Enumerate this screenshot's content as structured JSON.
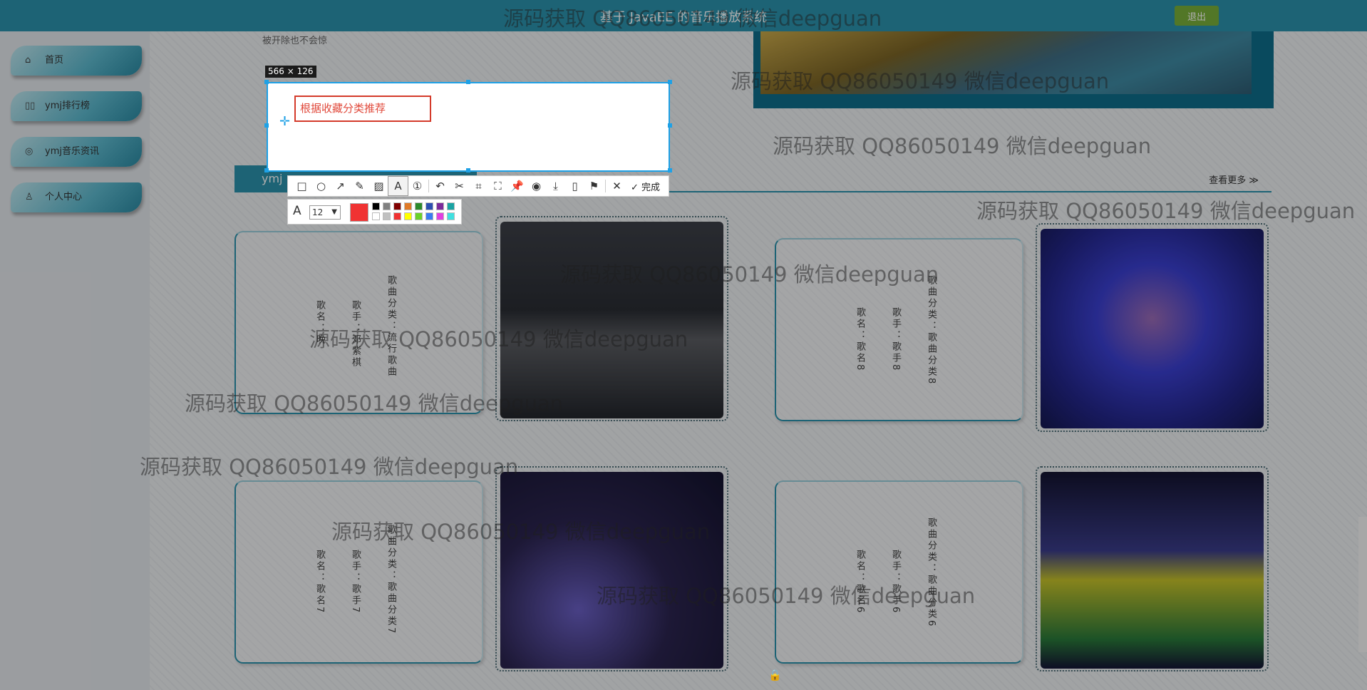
{
  "header": {
    "title": "基于 JavaEE 的音乐播放系统",
    "logout_label": "退出"
  },
  "sidebar": {
    "items": [
      {
        "icon": "home-icon",
        "label": "首页"
      },
      {
        "icon": "rank-icon",
        "label": "ymj排行榜"
      },
      {
        "icon": "news-icon",
        "label": "ymj音乐资讯"
      },
      {
        "icon": "user-icon",
        "label": "个人中心"
      }
    ]
  },
  "main": {
    "note": "被开除也不会惊",
    "section_title": "ymj",
    "more_label": "查看更多 ≫"
  },
  "songs": [
    {
      "name": "歌名：晚",
      "singer": "歌手：邓紫棋",
      "category": "歌曲分类：流行歌曲",
      "image_colors": [
        "#31343c",
        "#5a5d63",
        "#1e2228"
      ]
    },
    {
      "name": "歌名：歌名8",
      "singer": "歌手：歌手8",
      "category": "歌曲分类：歌曲分类8",
      "image_colors": [
        "#2b2f9a",
        "#3a3fd0",
        "#1a1d6b"
      ]
    },
    {
      "name": "歌名：歌名7",
      "singer": "歌手：歌手7",
      "category": "歌曲分类：歌曲分类7",
      "image_colors": [
        "#1b1d55",
        "#6a5fc4",
        "#2b244f"
      ]
    },
    {
      "name": "歌名：歌名6",
      "singer": "歌手：歌手6",
      "category": "歌曲分类：歌曲分类6",
      "image_colors": [
        "#c6c22a",
        "#3a3c8a",
        "#151535"
      ]
    }
  ],
  "capture": {
    "size_label": "566 × 126",
    "text": "根据收藏分类推荐",
    "font_size": "12",
    "current_color": "#f03333",
    "palette": [
      "#000000",
      "#808080",
      "#800000",
      "#e07b28",
      "#2c8a2c",
      "#2c4fb0",
      "#7a2a9a",
      "#1aa3a3",
      "#ffffff",
      "#c0c0c0",
      "#f03333",
      "#ffff00",
      "#6ad12a",
      "#3a7bf0",
      "#e040e0",
      "#40e0e0"
    ],
    "done_label": "完成"
  },
  "watermark": "源码获取 QQ86050149 微信deepguan"
}
